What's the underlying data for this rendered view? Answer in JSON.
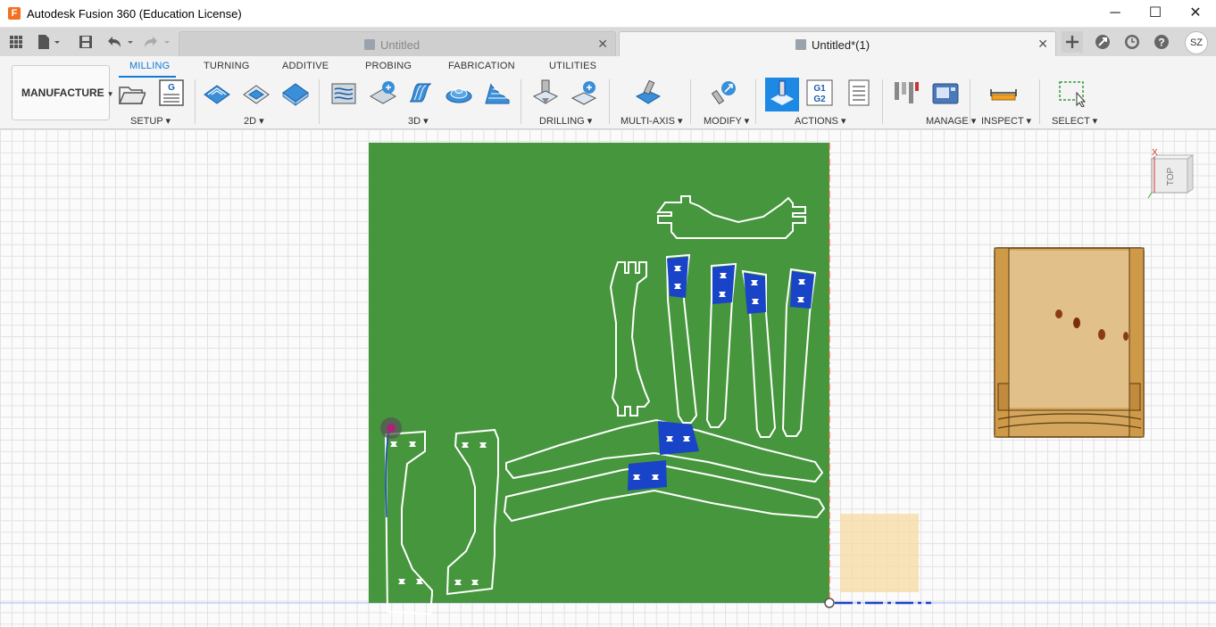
{
  "window": {
    "title": "Autodesk Fusion 360 (Education License)",
    "app_icon": "F",
    "controls": {
      "minimize": "─",
      "maximize": "☐",
      "close": "✕"
    }
  },
  "tabs": [
    {
      "label": "Untitled",
      "active": false,
      "close": "✕"
    },
    {
      "label": "Untitled*(1)",
      "active": true,
      "close": "✕"
    }
  ],
  "user": {
    "initials": "SZ"
  },
  "toolbar": {
    "workspace": "MANUFACTURE",
    "tabs": [
      "MILLING",
      "TURNING",
      "ADDITIVE",
      "PROBING",
      "FABRICATION",
      "UTILITIES"
    ],
    "groups": {
      "setup": "SETUP",
      "two_d": "2D",
      "three_d": "3D",
      "drilling": "DRILLING",
      "multi_axis": "MULTI-AXIS",
      "modify": "MODIFY",
      "actions": "ACTIONS",
      "manage": "MANAGE",
      "inspect": "INSPECT",
      "select": "SELECT"
    },
    "nc_icon_text": "G",
    "g1g2_icon_text": "G1 G2"
  },
  "viewcube": {
    "face": "TOP",
    "axis_x": "X",
    "axis_y": "Y"
  },
  "colors": {
    "accent": "#0f7ad8",
    "stock_green": "#45963c",
    "selected_blue": "#1a44c8",
    "wood": "#d7a65a"
  }
}
